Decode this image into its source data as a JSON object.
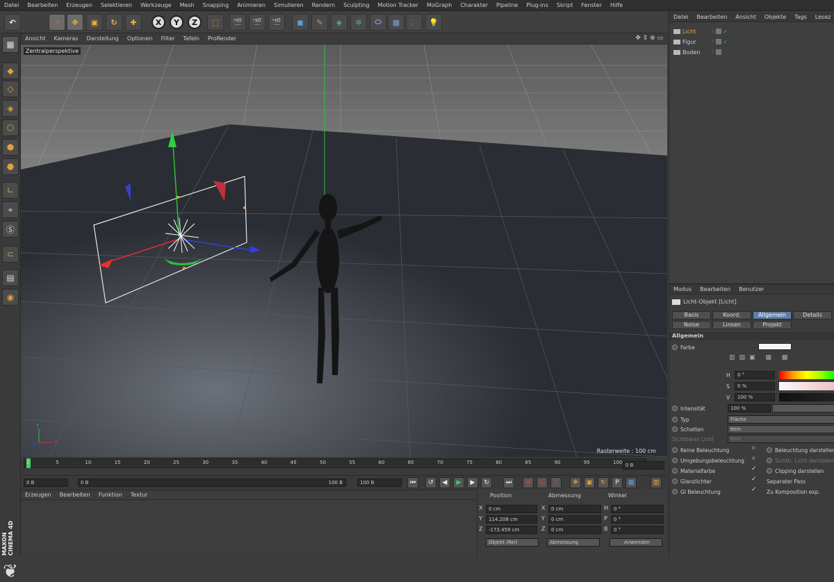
{
  "menubar": [
    "Datei",
    "Bearbeiten",
    "Erzeugen",
    "Selektieren",
    "Werkzeuge",
    "Mesh",
    "Snapping",
    "Animieren",
    "Simulieren",
    "Rendern",
    "Sculpting",
    "Motion Tracker",
    "MoGraph",
    "Charakter",
    "Pipeline",
    "Plug-ins",
    "Skript",
    "Fenster",
    "Hilfe"
  ],
  "toolbar": {
    "undo_icon": "undo-icon",
    "axis": [
      "X",
      "Y",
      "Z"
    ]
  },
  "viewport": {
    "menu": [
      "Ansicht",
      "Kameras",
      "Darstellung",
      "Optionen",
      "Filter",
      "Tafeln",
      "ProRender"
    ],
    "label": "Zentralperspektive",
    "grid_info": "Rasterweite : 100 cm"
  },
  "timeline": {
    "ticks": [
      "0",
      "5",
      "10",
      "15",
      "20",
      "25",
      "30",
      "35",
      "40",
      "45",
      "50",
      "55",
      "60",
      "65",
      "70",
      "75",
      "80",
      "85",
      "90",
      "95",
      "100"
    ],
    "frame_display": "0 B",
    "playhead": 0
  },
  "transport": {
    "start": "0 B",
    "preview_start": "0 B",
    "preview_end": "100 B",
    "end": "100 B"
  },
  "material_manager": {
    "menu": [
      "Erzeugen",
      "Bearbeiten",
      "Funktion",
      "Textur"
    ]
  },
  "coords": {
    "headers": [
      "Position",
      "Abmessung",
      "Winkel"
    ],
    "rows": [
      {
        "axis": "X",
        "pos": "0 cm",
        "dim_axis": "X",
        "dim": "0 cm",
        "rot_axis": "H",
        "rot": "0 °"
      },
      {
        "axis": "Y",
        "pos": "114.208 cm",
        "dim_axis": "Y",
        "dim": "0 cm",
        "rot_axis": "P",
        "rot": "0 °"
      },
      {
        "axis": "Z",
        "pos": "-173.459 cm",
        "dim_axis": "Z",
        "dim": "0 cm",
        "rot_axis": "B",
        "rot": "0 °"
      }
    ],
    "mode": "Objekt (Rel)",
    "size_mode": "Abmessung",
    "apply": "Anwenden"
  },
  "object_manager": {
    "menu": [
      "Datei",
      "Bearbeiten",
      "Ansicht",
      "Objekte",
      "Tags",
      "Lesez"
    ],
    "objects": [
      {
        "name": "Licht",
        "color": "#f0a040"
      },
      {
        "name": "Figur",
        "color": "#cfcfcf"
      },
      {
        "name": "Boden",
        "color": "#cfcfcf"
      }
    ]
  },
  "attribute_manager": {
    "menu": [
      "Modus",
      "Bearbeiten",
      "Benutzer"
    ],
    "object_title": "Licht-Objekt [Licht]",
    "tabs_row1": [
      "Basis",
      "Koord.",
      "Allgemein",
      "Details"
    ],
    "tabs_row2": [
      "Noise",
      "Linsen",
      "Projekt"
    ],
    "active_tab": "Allgemein",
    "section": "Allgemein",
    "farbe_label": "Farbe",
    "h_label": "H",
    "h": "0 °",
    "s_label": "S",
    "s": "0 %",
    "v_label": "V",
    "v": "100 %",
    "intensitaet_label": "Intensität",
    "intensitaet": "100 %",
    "typ_label": "Typ",
    "typ": "Fläche",
    "schatten_label": "Schatten",
    "schatten": "Kein",
    "sichtbar_label": "Sichtbares Licht",
    "sichtbar": "Kein",
    "left_checks": [
      "Keine Beleuchtung",
      "Umgebungsbeleuchtung",
      "Materialfarbe",
      "Glanzlichter",
      "GI Beleuchtung"
    ],
    "right_checks": [
      "Beleuchtung darstellen",
      "Sichtb. Licht darstellen",
      "Clipping darstellen",
      "Separater Pass",
      "Zu Komposition exp."
    ]
  },
  "brand": "MAXON CINEMA 4D"
}
